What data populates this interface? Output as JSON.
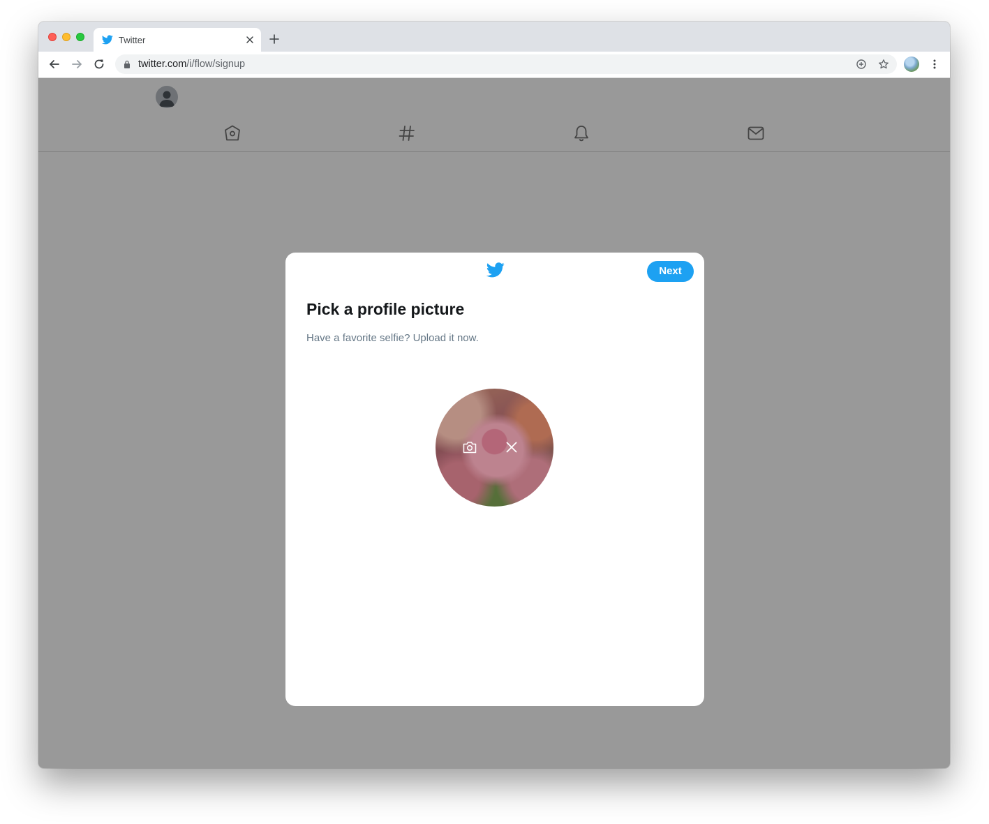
{
  "browser": {
    "tab": {
      "title": "Twitter"
    },
    "address_bar": {
      "host": "twitter.com",
      "path": "/i/flow/signup"
    }
  },
  "modal": {
    "next_label": "Next",
    "title": "Pick a profile picture",
    "subtitle": "Have a favorite selfie? Upload it now."
  },
  "colors": {
    "twitter_blue": "#1da1f2",
    "overlay": "#999999"
  },
  "icons": {
    "page_nav": [
      "home-icon",
      "hashtag-icon",
      "bell-icon",
      "mail-icon"
    ],
    "photo_actions": [
      "camera-icon",
      "close-icon"
    ]
  }
}
